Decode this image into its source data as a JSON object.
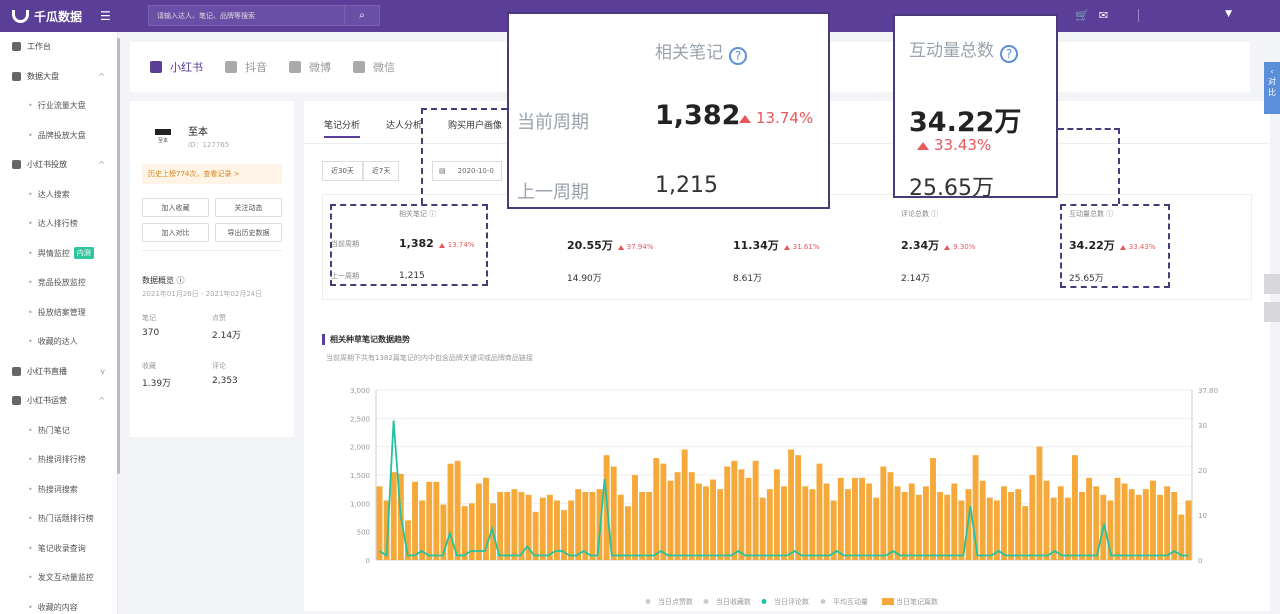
{
  "app": {
    "name": "千瓜数据"
  },
  "search": {
    "placeholder": "请输入达人、笔记、品牌等搜索"
  },
  "sidebar": {
    "items": [
      {
        "label": "工作台",
        "type": "top"
      },
      {
        "label": "数据大盘",
        "type": "group",
        "arrow": "^"
      },
      {
        "label": "行业流量大盘",
        "type": "sub"
      },
      {
        "label": "品牌投放大盘",
        "type": "sub"
      },
      {
        "label": "小红书投放",
        "type": "group",
        "arrow": "^"
      },
      {
        "label": "达人搜索",
        "type": "sub"
      },
      {
        "label": "达人排行榜",
        "type": "sub"
      },
      {
        "label": "舆情监控",
        "type": "sub",
        "tag": "内测"
      },
      {
        "label": "竞品投放监控",
        "type": "sub"
      },
      {
        "label": "投放结案管理",
        "type": "sub"
      },
      {
        "label": "收藏的达人",
        "type": "sub"
      },
      {
        "label": "小红书直播",
        "type": "group",
        "arrow": "v"
      },
      {
        "label": "小红书运营",
        "type": "group",
        "arrow": "^"
      },
      {
        "label": "热门笔记",
        "type": "sub"
      },
      {
        "label": "热搜词排行榜",
        "type": "sub"
      },
      {
        "label": "热搜词搜索",
        "type": "sub"
      },
      {
        "label": "热门话题排行榜",
        "type": "sub"
      },
      {
        "label": "笔记收录查询",
        "type": "sub"
      },
      {
        "label": "发文互动量监控",
        "type": "sub"
      },
      {
        "label": "收藏的内容",
        "type": "sub"
      }
    ]
  },
  "platforms": [
    {
      "label": "小红书",
      "active": true
    },
    {
      "label": "抖音",
      "active": false
    },
    {
      "label": "微博",
      "active": false
    },
    {
      "label": "微信",
      "active": false
    }
  ],
  "brand": {
    "name": "至本",
    "id": "ID：127765",
    "logo_text": "至本",
    "history": "历史上榜774次，查看记录 >",
    "actions": [
      "加入收藏",
      "关注动态",
      "加入对比",
      "导出历史数据"
    ],
    "overview_title": "数据概览 ⓘ",
    "overview_date": "2021年01月26日 - 2021年02月24日",
    "stats": [
      {
        "label": "笔记",
        "value": "370"
      },
      {
        "label": "点赞",
        "value": "2.14万"
      },
      {
        "label": "收藏",
        "value": "1.39万"
      },
      {
        "label": "评论",
        "value": "2,353"
      }
    ]
  },
  "tabs": [
    "笔记分析",
    "达人分析",
    "购买用户画像"
  ],
  "range_buttons": [
    "近30天",
    "近7天"
  ],
  "date_text": "2020-10-0",
  "metrics": {
    "row_current": "当前周期",
    "row_prev": "上一周期",
    "cols": [
      {
        "title": "相关笔记 ⓘ",
        "value": "1,382",
        "pct": "13.74%",
        "prev": "1,215"
      },
      {
        "title": "",
        "value": "20.55万",
        "pct": "37.94%",
        "prev": "14.90万"
      },
      {
        "title": "",
        "value": "11.34万",
        "pct": "31.61%",
        "prev": "8.61万"
      },
      {
        "title": "评论总数 ⓘ",
        "value": "2.34万",
        "pct": "9.30%",
        "prev": "2.14万"
      },
      {
        "title": "互动量总数 ⓘ",
        "value": "34.22万",
        "pct": "33.43%",
        "prev": "25.65万"
      }
    ]
  },
  "zoom_notes": {
    "title": "相关笔记",
    "current_label": "当前周期",
    "prev_label": "上一周期",
    "value": "1,382",
    "pct": "13.74%",
    "prev": "1,215"
  },
  "zoom_interaction": {
    "title": "互动量总数",
    "value": "34.22万",
    "pct": "33.43%",
    "prev": "25.65万"
  },
  "chart_section": {
    "title": "相关种草笔记数据趋势",
    "subtitle": "当前周期下共有1382篇笔记的内中包含品牌关键词或品牌商品链接"
  },
  "chart_data": {
    "type": "bar",
    "ylim_left": [
      0,
      3000
    ],
    "yticks_left": [
      "0",
      "500",
      "1,000",
      "1,500",
      "2,000",
      "2,500",
      "3,000"
    ],
    "ylim_right": [
      0,
      37.8
    ],
    "yticks_right": [
      "0",
      "10",
      "20",
      "30",
      "37.80"
    ],
    "legend": [
      "当日点赞数",
      "当日收藏数",
      "当日评论数",
      "平均互动量",
      "当日笔记篇数"
    ],
    "bar_values": [
      1300,
      1050,
      1550,
      1520,
      700,
      1380,
      1050,
      1380,
      1380,
      980,
      1700,
      1750,
      950,
      1000,
      1350,
      1450,
      1000,
      1200,
      1200,
      1250,
      1200,
      1150,
      850,
      1100,
      1150,
      1050,
      880,
      1050,
      1250,
      1200,
      1200,
      1250,
      1850,
      1650,
      1150,
      950,
      1500,
      1200,
      1200,
      1800,
      1700,
      1400,
      1550,
      1950,
      1550,
      1350,
      1300,
      1420,
      1250,
      1650,
      1750,
      1600,
      1450,
      1750,
      1100,
      1250,
      1600,
      1300,
      1950,
      1850,
      1300,
      1250,
      1700,
      1350,
      1050,
      1450,
      1250,
      1450,
      1450,
      1350,
      1100,
      1650,
      1550,
      1300,
      1200,
      1350,
      1150,
      1300,
      1800,
      1200,
      1150,
      1350,
      1050,
      1250,
      1850,
      1400,
      1100,
      1050,
      1300,
      1200,
      1250,
      950,
      1500,
      2000,
      1400,
      1100,
      1300,
      1100,
      1850,
      1200,
      1450,
      1300,
      1150,
      1050,
      1450,
      1350,
      1250,
      1150,
      1250,
      1400,
      1150,
      1300,
      1200,
      800,
      1050
    ],
    "line_values": [
      2,
      1,
      31,
      10,
      1,
      1,
      2,
      1,
      1,
      1,
      6,
      1,
      1,
      2,
      2,
      2,
      7,
      1,
      1,
      1,
      1,
      3,
      1,
      1,
      1,
      2,
      2,
      1,
      1,
      2,
      1,
      1,
      18,
      1,
      1,
      1,
      1,
      1,
      1,
      1,
      2,
      1,
      1,
      1,
      1,
      1,
      1,
      1,
      1,
      1,
      1,
      2,
      1,
      1,
      1,
      1,
      1,
      1,
      1,
      2,
      1,
      1,
      1,
      1,
      1,
      2,
      1,
      1,
      1,
      1,
      1,
      1,
      1,
      2,
      1,
      1,
      1,
      1,
      1,
      1,
      1,
      1,
      1,
      1,
      12,
      1,
      1,
      1,
      2,
      1,
      1,
      1,
      1,
      1,
      1,
      1,
      2,
      1,
      1,
      1,
      1,
      1,
      1,
      8,
      1,
      1,
      1,
      1,
      1,
      1,
      1,
      1,
      1,
      2,
      1,
      1
    ]
  }
}
